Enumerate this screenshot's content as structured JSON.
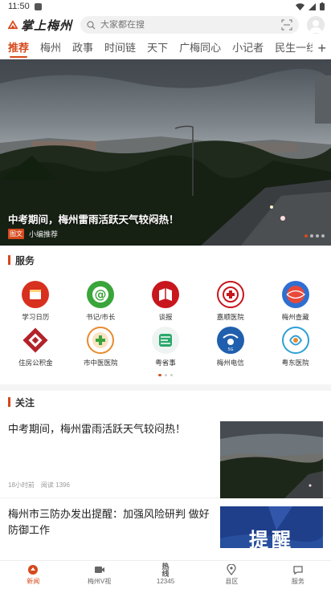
{
  "status_bar": {
    "time": "11:50"
  },
  "header": {
    "logo_text": "掌上梅州",
    "search_placeholder": "大家都在搜"
  },
  "tabs": [
    {
      "label": "推荐",
      "active": true
    },
    {
      "label": "梅州"
    },
    {
      "label": "政事"
    },
    {
      "label": "时间链"
    },
    {
      "label": "天下"
    },
    {
      "label": "广梅同心"
    },
    {
      "label": "小记者"
    },
    {
      "label": "民生一线"
    }
  ],
  "tab_plus": "+",
  "banner": {
    "caption": "中考期间，梅州雷雨活跃天气较闷热！",
    "badge": "图文",
    "source": "小编推荐",
    "slide_count": 4,
    "active_slide": 0
  },
  "services": {
    "title": "服务",
    "items": [
      {
        "label": "学习日历",
        "icon": "calendar-icon",
        "color": "#d8301f"
      },
      {
        "label": "书记/市长",
        "icon": "at-sign-icon",
        "color": "#3aa53a"
      },
      {
        "label": "谈报",
        "icon": "book-icon",
        "color": "#c8161d"
      },
      {
        "label": "嘉顺医院",
        "icon": "hospital-emblem-icon",
        "color": "#c8161d"
      },
      {
        "label": "梅州查藏",
        "icon": "globe-icon",
        "color": "#2f6fd1"
      },
      {
        "label": "住房公积金",
        "icon": "housing-fund-icon",
        "color": "#b3222a"
      },
      {
        "label": "市中医医院",
        "icon": "tcm-hospital-icon",
        "color": "#e98a2b"
      },
      {
        "label": "粤省事",
        "icon": "yue-app-icon",
        "color": "#2aa86c"
      },
      {
        "label": "梅州电信",
        "icon": "telecom-icon",
        "color": "#1f5fae"
      },
      {
        "label": "粤东医院",
        "icon": "east-hospital-icon",
        "color": "#2ea0d4"
      }
    ],
    "pages": 3,
    "active_page": 0
  },
  "follow": {
    "title": "关注",
    "items": [
      {
        "title": "中考期间，梅州雷雨活跃天气较闷热！",
        "time": "18小时前",
        "reads": "阅读 1396",
        "thumb": "storm-photo"
      },
      {
        "title": "梅州市三防办发出提醒：加强风险研判 做好防御工作",
        "thumb": "reminder-poster",
        "thumb_text": "提醒"
      }
    ]
  },
  "bottom_nav": [
    {
      "label": "新闻",
      "icon": "news-icon",
      "active": true
    },
    {
      "label": "梅州V视",
      "icon": "video-icon"
    },
    {
      "label": "12345",
      "icon": "hotline-icon",
      "icon_text": "热线"
    },
    {
      "label": "县区",
      "icon": "location-icon"
    },
    {
      "label": "服务",
      "icon": "service-icon"
    }
  ]
}
